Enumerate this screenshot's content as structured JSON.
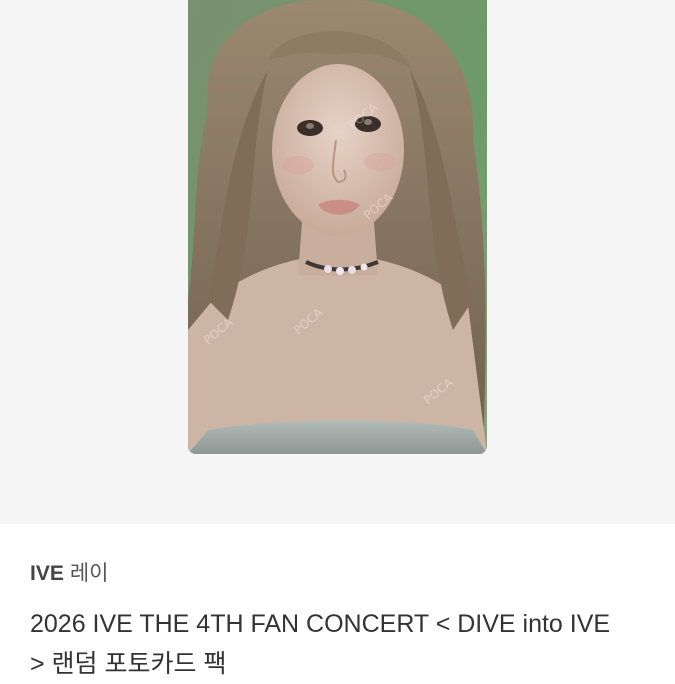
{
  "product_image": {
    "watermark": "POCA",
    "colors": {
      "background": "#f5f5f5",
      "backdrop": "#6f8a6a",
      "hair": "#8d7a63",
      "skin": "#d9c2b4",
      "top": "#9aa5a2"
    }
  },
  "product": {
    "artist": "IVE",
    "member": "레이",
    "title": "2026 IVE THE 4TH FAN CONCERT < DIVE into IVE > 랜덤 포토카드 팩"
  }
}
